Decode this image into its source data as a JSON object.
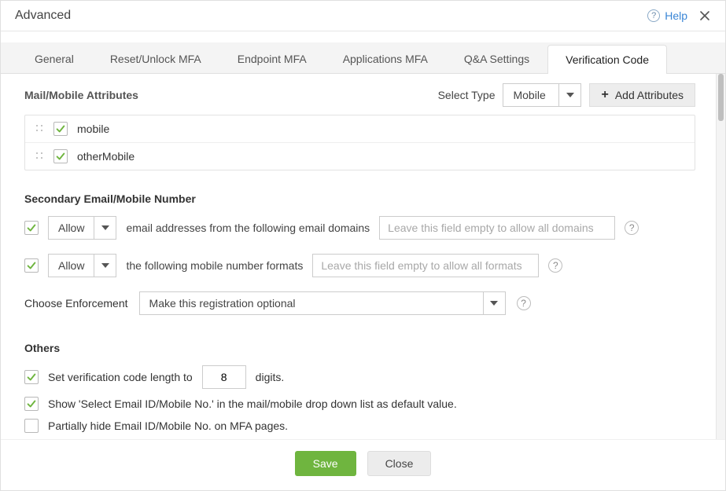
{
  "header": {
    "title": "Advanced",
    "help_label": "Help"
  },
  "tabs": [
    {
      "label": "General"
    },
    {
      "label": "Reset/Unlock MFA"
    },
    {
      "label": "Endpoint MFA"
    },
    {
      "label": "Applications MFA"
    },
    {
      "label": "Q&A Settings"
    },
    {
      "label": "Verification Code"
    }
  ],
  "mail_attrs": {
    "section_title": "Mail/Mobile Attributes",
    "select_type_label": "Select Type",
    "select_type_value": "Mobile",
    "add_attrs_label": "Add Attributes",
    "items": [
      {
        "name": "mobile"
      },
      {
        "name": "otherMobile"
      }
    ]
  },
  "secondary": {
    "section_title": "Secondary Email/Mobile Number",
    "email_dropdown": "Allow",
    "email_text": "email addresses from the following email domains",
    "email_placeholder": "Leave this field empty to allow all domains",
    "mobile_dropdown": "Allow",
    "mobile_text": "the following mobile number formats",
    "mobile_placeholder": "Leave this field empty to allow all formats",
    "enforce_label": "Choose Enforcement",
    "enforce_value": "Make this registration optional"
  },
  "others": {
    "section_title": "Others",
    "r1_before": "Set verification code length to",
    "r1_value": "8",
    "r1_after": "digits.",
    "r2": "Show 'Select Email ID/Mobile No.' in the mail/mobile drop down list as default value.",
    "r3": "Partially hide Email ID/Mobile No. on MFA pages."
  },
  "footer": {
    "save": "Save",
    "close": "Close"
  }
}
